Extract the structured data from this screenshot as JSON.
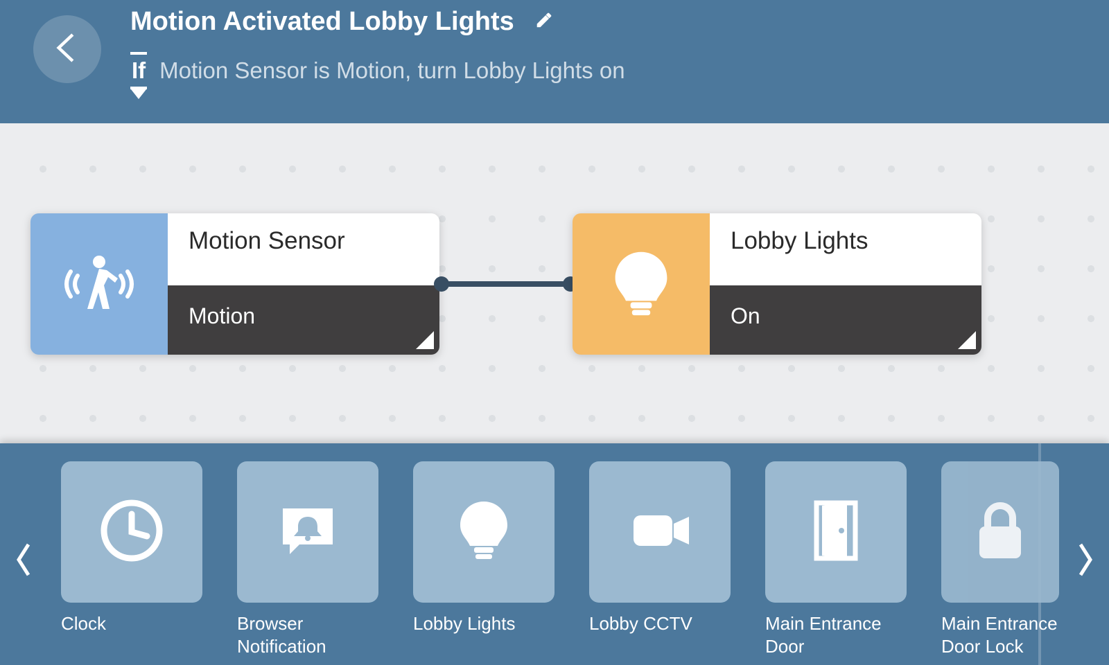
{
  "header": {
    "title": "Motion Activated Lobby Lights",
    "condition_prefix": "If",
    "condition_text": "Motion Sensor is Motion, turn Lobby Lights on"
  },
  "nodes": {
    "trigger": {
      "icon": "motion-sensor-icon",
      "title": "Motion Sensor",
      "state": "Motion"
    },
    "action": {
      "icon": "lightbulb-icon",
      "title": "Lobby Lights",
      "state": "On"
    }
  },
  "tray": {
    "items": [
      {
        "icon": "clock-icon",
        "label": "Clock"
      },
      {
        "icon": "bell-icon",
        "label": "Browser Notification"
      },
      {
        "icon": "lightbulb-icon",
        "label": "Lobby Lights"
      },
      {
        "icon": "camera-icon",
        "label": "Lobby CCTV"
      },
      {
        "icon": "door-icon",
        "label": "Main Entrance Door"
      },
      {
        "icon": "lock-icon",
        "label": "Main Entrance Door Lock"
      }
    ]
  }
}
